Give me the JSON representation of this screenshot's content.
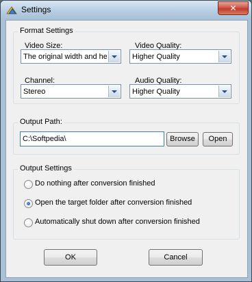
{
  "window": {
    "title": "Settings",
    "close_glyph": "✕",
    "icon": "settings-app-icon"
  },
  "format_settings": {
    "title": "Format Settings",
    "video_size": {
      "label": "Video Size:",
      "value": "The original width and heig"
    },
    "video_quality": {
      "label": "Video Quality:",
      "value": "Higher Quality"
    },
    "channel": {
      "label": "Channel:",
      "value": "Stereo"
    },
    "audio_quality": {
      "label": "Audio Quality:",
      "value": "Higher Quality"
    }
  },
  "output_path": {
    "title": "Output Path:",
    "value": "C:\\Softpedia\\",
    "browse_label": "Browse",
    "open_label": "Open"
  },
  "output_settings": {
    "title": "Output Settings",
    "options": [
      {
        "label": "Do nothing after conversion finished",
        "checked": false
      },
      {
        "label": "Open the target folder after conversion finished",
        "checked": true
      },
      {
        "label": "Automatically shut down after conversion finished",
        "checked": false
      }
    ]
  },
  "buttons": {
    "ok_label": "OK",
    "cancel_label": "Cancel"
  },
  "colors": {
    "title_bar": "#b7cde2",
    "close_button": "#c23b2b",
    "client": "#f0f0f0",
    "focus_border": "#3c7fb1"
  }
}
